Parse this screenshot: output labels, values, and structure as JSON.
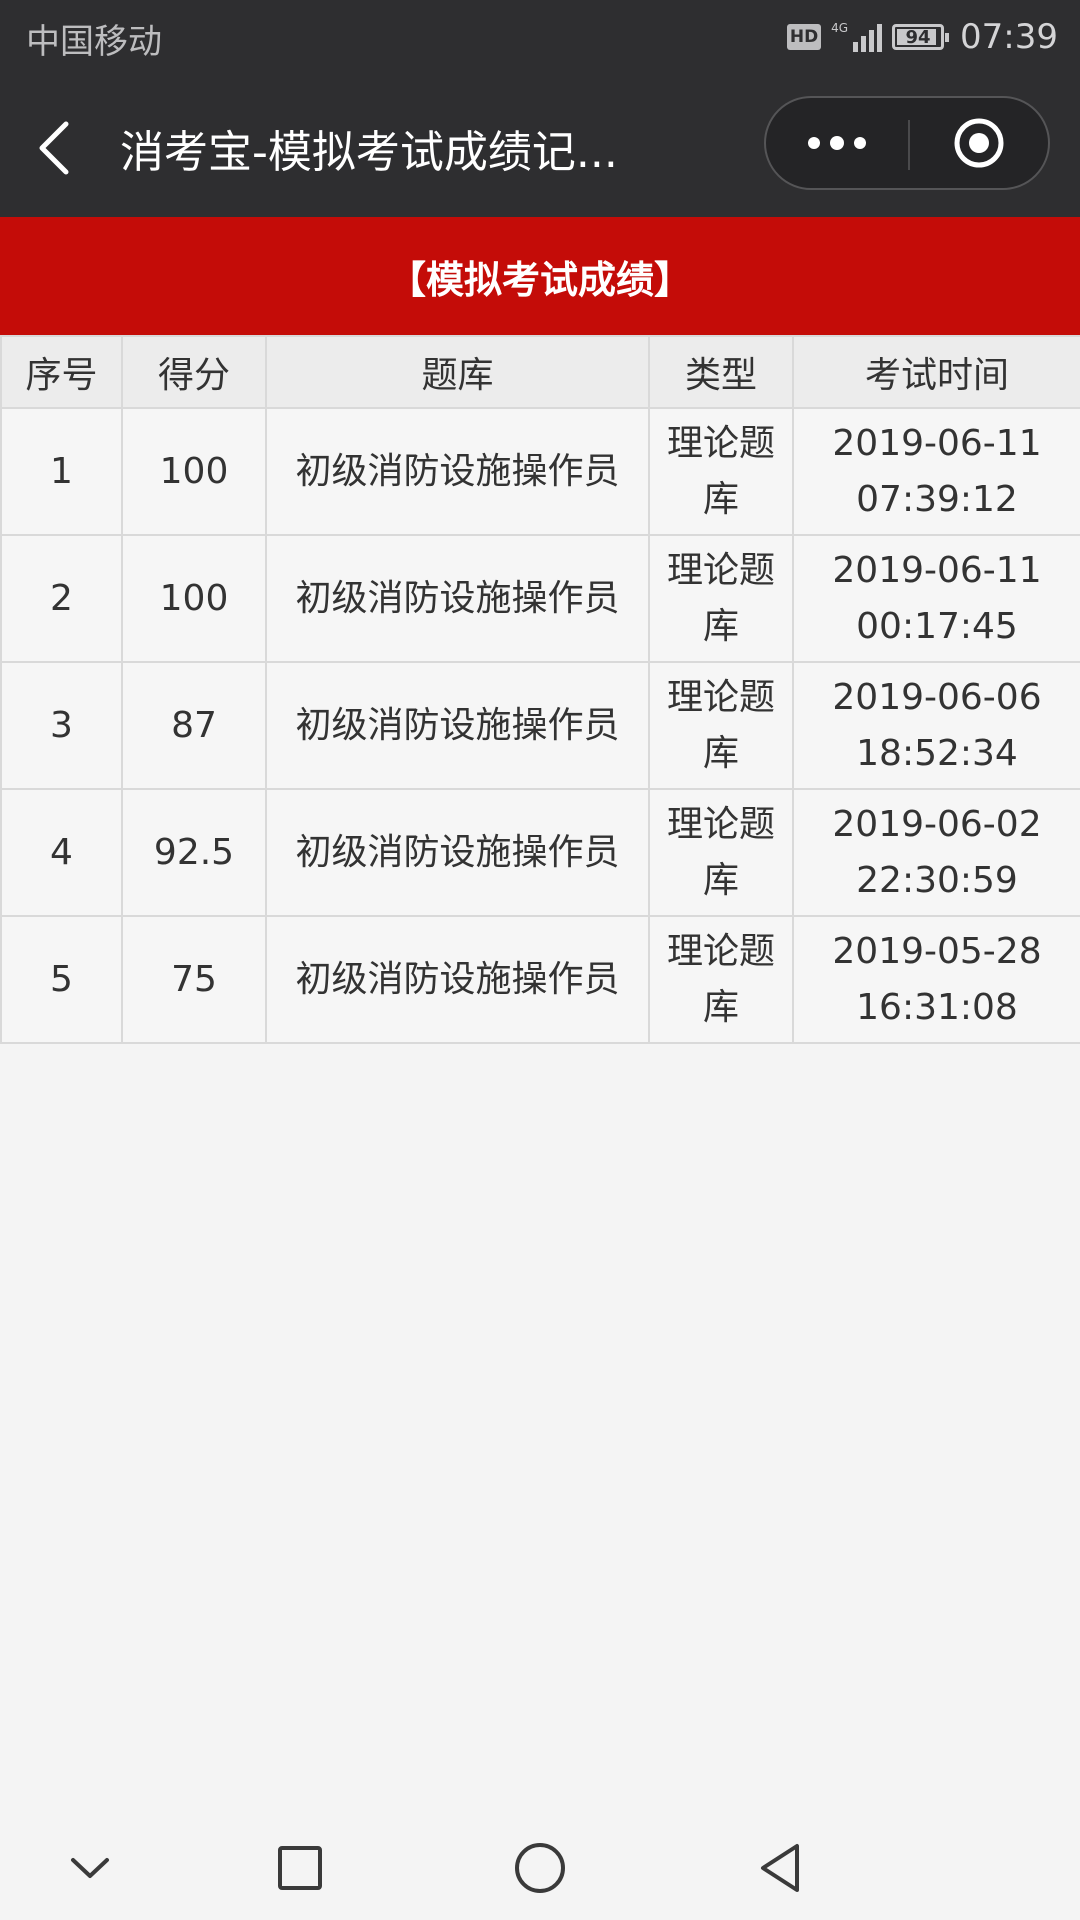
{
  "status_bar": {
    "carrier": "中国移动",
    "hd_label": "HD",
    "network_label": "4G",
    "battery_level": "94",
    "battery_fraction": 0.94,
    "time": "07:39"
  },
  "nav": {
    "title": "消考宝-模拟考试成绩记...",
    "back_icon": "chevron-left-icon",
    "more_icon": "more-dots-icon",
    "close_icon": "target-circle-icon"
  },
  "banner": {
    "title": "【模拟考试成绩】",
    "color": "#c40c08"
  },
  "table": {
    "headers": [
      "序号",
      "得分",
      "题库",
      "类型",
      "考试时间"
    ],
    "rows": [
      {
        "index": "1",
        "score": "100",
        "bank": "初级消防设施操作员",
        "type": "理论题库",
        "date": "2019-06-11",
        "time": "07:39:12"
      },
      {
        "index": "2",
        "score": "100",
        "bank": "初级消防设施操作员",
        "type": "理论题库",
        "date": "2019-06-11",
        "time": "00:17:45"
      },
      {
        "index": "3",
        "score": "87",
        "bank": "初级消防设施操作员",
        "type": "理论题库",
        "date": "2019-06-06",
        "time": "18:52:34"
      },
      {
        "index": "4",
        "score": "92.5",
        "bank": "初级消防设施操作员",
        "type": "理论题库",
        "date": "2019-06-02",
        "time": "22:30:59"
      },
      {
        "index": "5",
        "score": "75",
        "bank": "初级消防设施操作员",
        "type": "理论题库",
        "date": "2019-05-28",
        "time": "16:31:08"
      }
    ]
  },
  "system_nav": {
    "icons": [
      "chevron-down-icon",
      "square-recents-icon",
      "circle-home-icon",
      "triangle-back-icon"
    ]
  }
}
